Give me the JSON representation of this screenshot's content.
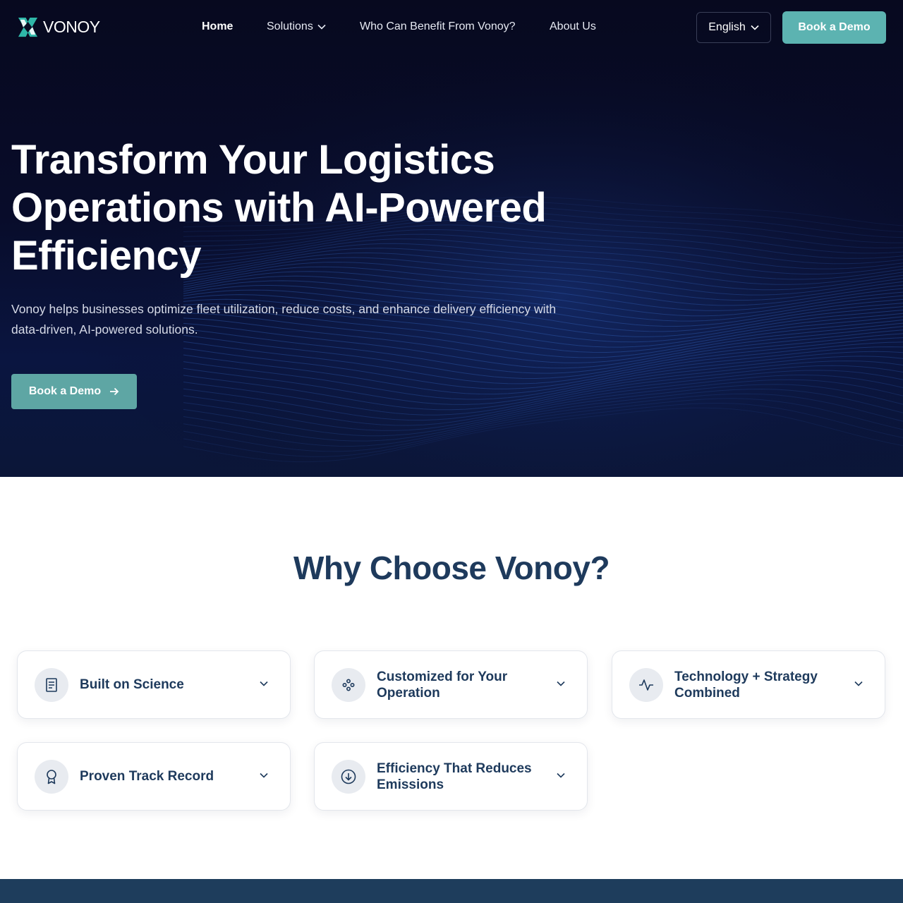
{
  "brand": {
    "name": "VONOY",
    "accent_teal": "#5cb3b1",
    "navy": "#1e3a5c"
  },
  "nav": {
    "items": [
      {
        "label": "Home"
      },
      {
        "label": "Solutions"
      },
      {
        "label": "Who Can Benefit From Vonoy?"
      },
      {
        "label": "About Us"
      }
    ],
    "language": "English",
    "cta": "Book a Demo"
  },
  "hero": {
    "title": "Transform Your Logistics Operations with AI-Powered Efficiency",
    "subtitle": "Vonoy helps businesses optimize fleet utilization, reduce costs, and enhance delivery efficiency with data-driven, AI-powered solutions.",
    "cta": "Book a Demo"
  },
  "why": {
    "title": "Why Choose Vonoy?",
    "cards": [
      {
        "label": "Built on Science",
        "icon": "document-icon"
      },
      {
        "label": "Customized for Your Operation",
        "icon": "nodes-icon"
      },
      {
        "label": "Technology + Strategy Combined",
        "icon": "activity-icon"
      },
      {
        "label": "Proven Track Record",
        "icon": "award-icon"
      },
      {
        "label": "Efficiency That Reduces Emissions",
        "icon": "arrow-down-circle-icon"
      }
    ]
  }
}
